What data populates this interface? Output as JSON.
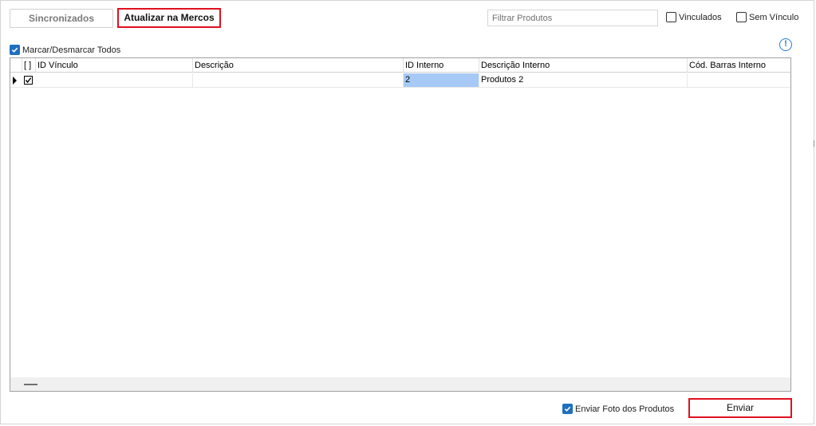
{
  "toolbar": {
    "sync_label": "Sincronizados",
    "update_label": "Atualizar na Mercos"
  },
  "filter": {
    "placeholder": "Filtrar Produtos",
    "vinculados_label": "Vinculados",
    "vinculados_checked": false,
    "sem_vinculo_label": "Sem Vínculo",
    "sem_vinculo_checked": false
  },
  "select_all": {
    "label": "Marcar/Desmarcar Todos",
    "checked": true
  },
  "info_icon": "info-icon",
  "grid": {
    "columns": [
      "[ ]",
      "ID Vínculo",
      "Descrição",
      "ID Interno",
      "Descrição Interno",
      "Cód. Barras Interno"
    ],
    "rows": [
      {
        "checked": true,
        "id_vinculo": "",
        "descricao": "",
        "id_interno": "2",
        "descricao_interno": "Produtos 2",
        "cod_barras": ""
      }
    ]
  },
  "footer": {
    "enviar_foto_label": "Enviar Foto dos Produtos",
    "enviar_foto_checked": true,
    "enviar_label": "Enviar"
  },
  "colors": {
    "highlight_border": "#e01020",
    "checkbox_blue": "#1f6fbf",
    "selected_cell": "#a6caf5",
    "info_blue": "#2a7ad5"
  }
}
